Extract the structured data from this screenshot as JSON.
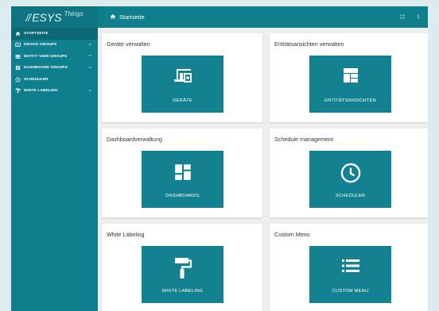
{
  "app": {
    "logo_mark": "//",
    "logo_text": "ESYS",
    "logo_sub": "Things"
  },
  "header": {
    "breadcrumb": "Startseite"
  },
  "sidebar": {
    "items": [
      {
        "label": "STARTSEITE",
        "icon": "home-icon",
        "active": true
      },
      {
        "label": "DEVICE GROUPS",
        "icon": "device-icon",
        "expandable": true
      },
      {
        "label": "ENTITY VIEW GROUPS",
        "icon": "entity-view-icon",
        "expandable": true
      },
      {
        "label": "DASHBOARD GROUPS",
        "icon": "dashboard-icon",
        "expandable": true
      },
      {
        "label": "SCHEDULER",
        "icon": "clock-icon"
      },
      {
        "label": "WHITE LABELING",
        "icon": "paint-roller-icon",
        "expandable": true
      }
    ]
  },
  "cards": [
    {
      "title": "Geräte verwalten",
      "tile": "GERÄTE",
      "icon": "devices-icon"
    },
    {
      "title": "Entitätsansichten verwalten",
      "tile": "ENTITÄTSANSICHTEN",
      "icon": "entity-view-icon"
    },
    {
      "title": "Dashboardverwaltung",
      "tile": "DASHBOARDS",
      "icon": "dashboard-icon"
    },
    {
      "title": "Schedule management",
      "tile": "SCHEDULER",
      "icon": "clock-icon"
    },
    {
      "title": "White Labeling",
      "tile": "WHITE LABELING",
      "icon": "paint-roller-icon"
    },
    {
      "title": "Custom Menu",
      "tile": "CUSTOM MENU",
      "icon": "list-icon"
    }
  ],
  "colors": {
    "primary": "#0f7f8e",
    "sidebar_active": "#0b6875",
    "tile": "#13818f",
    "background": "#eeeeee"
  }
}
